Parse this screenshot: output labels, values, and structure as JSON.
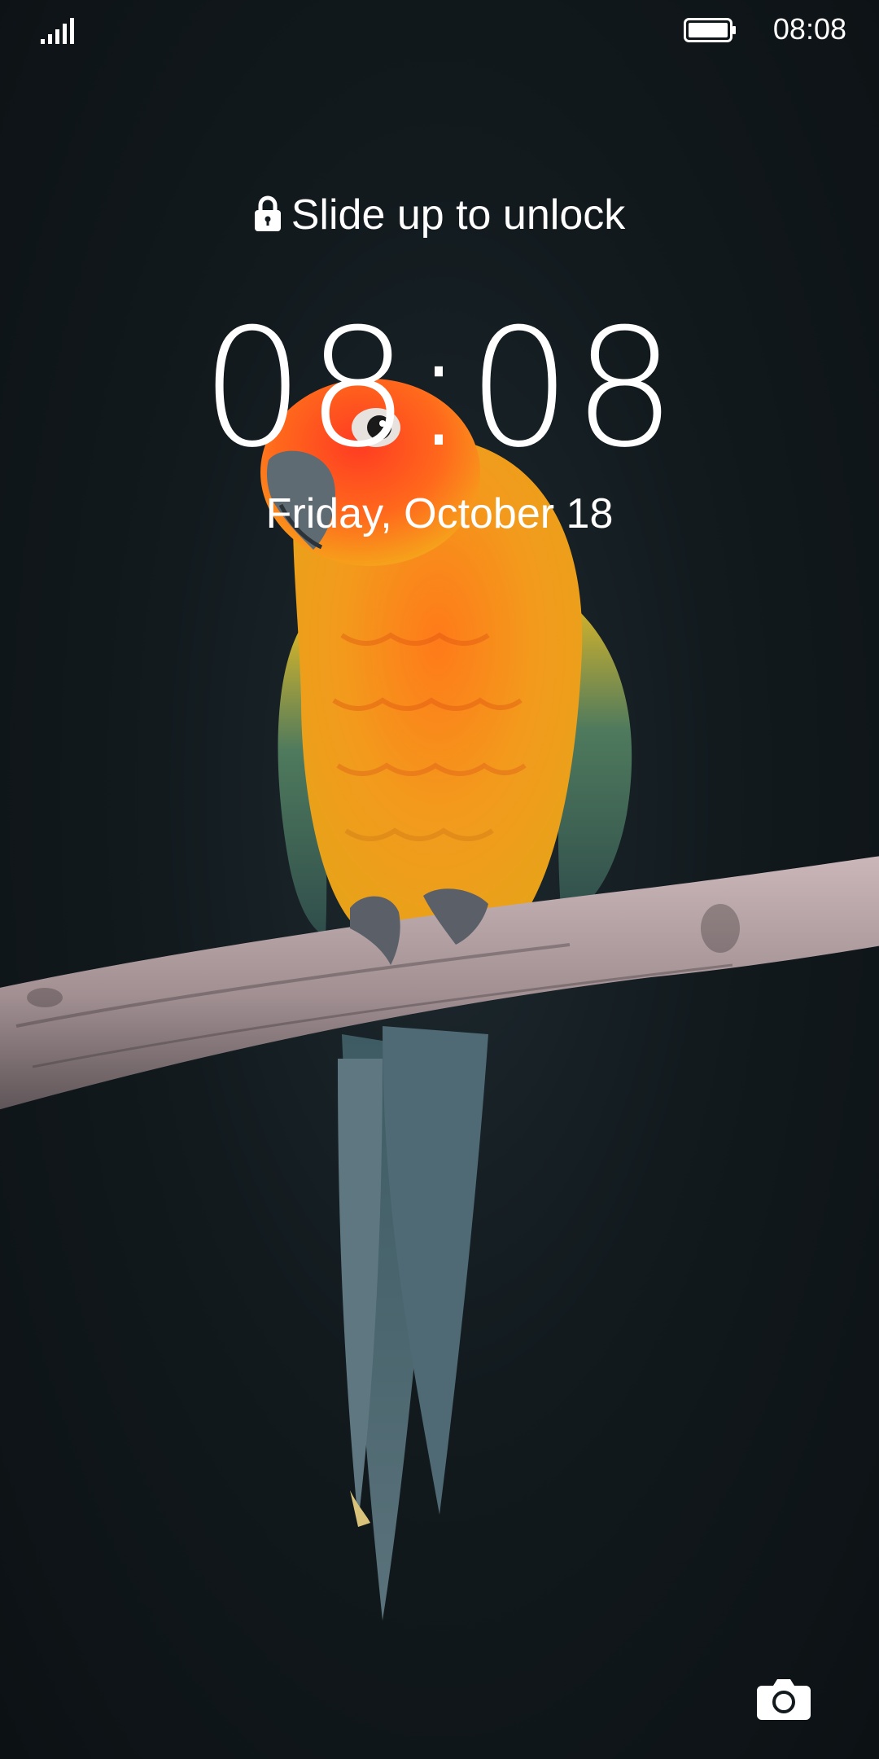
{
  "status_bar": {
    "signal_icon": "signal-bars-icon",
    "battery_icon": "battery-full-icon",
    "time": "08:08"
  },
  "lock_screen": {
    "lock_icon": "lock-icon",
    "unlock_hint": "Slide up to unlock",
    "clock": "08:08",
    "date": "Friday, October 18",
    "camera_icon": "camera-icon"
  },
  "wallpaper": {
    "subject": "parrot-on-branch",
    "colors": {
      "background": "#121a1e",
      "parrot_head": "#ff5a1f",
      "parrot_body": "#f7a21b",
      "parrot_wing": "#3f6e5c",
      "parrot_tail": "#4c6470",
      "branch": "#b7a4a6"
    }
  }
}
